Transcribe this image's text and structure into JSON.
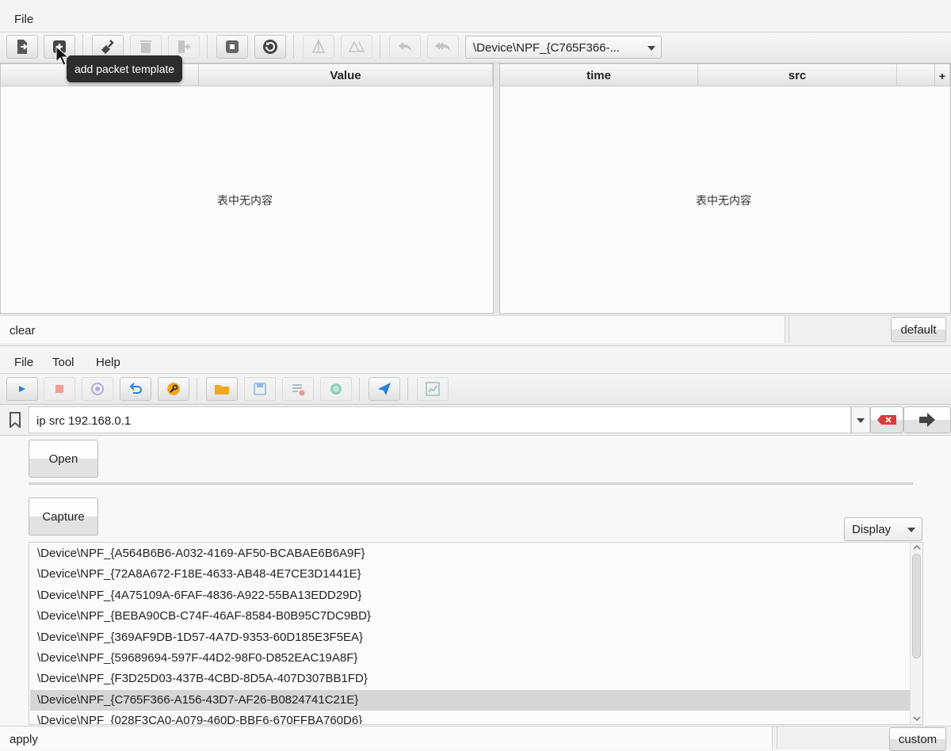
{
  "top": {
    "menu": [
      "File"
    ],
    "device_select": "\\Device\\NPF_{C765F366-...",
    "tooltip": "add packet template",
    "left_table": {
      "columns": [
        "Field",
        "Value"
      ],
      "empty_text": "表中无内容"
    },
    "right_table": {
      "columns": [
        "time",
        "src"
      ],
      "add_column": "+",
      "empty_text": "表中无内容"
    },
    "filter_value": "clear",
    "default_button": "default"
  },
  "bottom": {
    "menu": [
      "File",
      "Tool",
      "Help"
    ],
    "filter_value": "ip src 192.168.0.1",
    "open_button": "Open",
    "capture_button": "Capture",
    "display_select": "Display",
    "devices": [
      "\\Device\\NPF_{A564B6B6-A032-4169-AF50-BCABAE6B6A9F}",
      "\\Device\\NPF_{72A8A672-F18E-4633-AB48-4E7CE3D1441E}",
      "\\Device\\NPF_{4A75109A-6FAF-4836-A922-55BA13EDD29D}",
      "\\Device\\NPF_{BEBA90CB-C74F-46AF-8584-B0B95C7DC9BD}",
      "\\Device\\NPF_{369AF9DB-1D57-4A7D-9353-60D185E3F5EA}",
      "\\Device\\NPF_{59689694-597F-44D2-98F0-D852EAC19A8F}",
      "\\Device\\NPF_{F3D25D03-437B-4CBD-8D5A-407D307BB1FD}",
      "\\Device\\NPF_{C765F366-A156-43D7-AF26-B0824741C21E}",
      "\\Device\\NPF_{028F3CA0-A079-460D-BBF6-670FFBA760D6}"
    ],
    "selected_index": 7,
    "apply_value": "apply",
    "custom_button": "custom"
  },
  "colors": {
    "play": "#2a7fd6",
    "stop": "#e05a4a",
    "folder": "#f0a81e",
    "send": "#2a7fd6",
    "delete": "#d93a3a"
  }
}
